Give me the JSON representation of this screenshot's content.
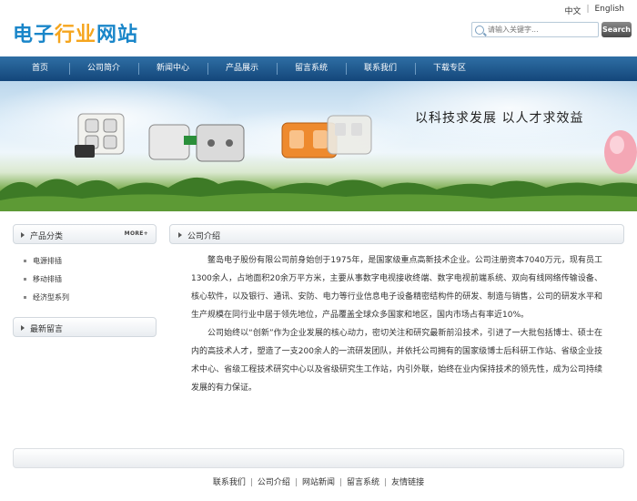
{
  "header": {
    "logo": [
      "电子",
      "行业",
      "网站"
    ],
    "lang": {
      "cn": "中文",
      "en": "English"
    },
    "search": {
      "placeholder": "请输入关键字...",
      "button": "Search"
    }
  },
  "nav": {
    "items": [
      "首页",
      "公司简介",
      "新闻中心",
      "产品展示",
      "留言系统",
      "联系我们",
      "下载专区"
    ]
  },
  "banner": {
    "slogan": "以科技求发展  以人才求效益"
  },
  "sidebar": {
    "products": {
      "title": "产品分类",
      "more": "MORE+",
      "items": [
        "电源排插",
        "移动排插",
        "经济型系列"
      ]
    },
    "messages": {
      "title": "最新留言"
    }
  },
  "main": {
    "title": "公司介绍",
    "paragraphs": [
      "鳖岛电子股份有限公司前身始创于1975年，是国家级重点高新技术企业。公司注册资本7040万元，现有员工1300余人，占地面积20余万平方米，主要从事数字电视接收终端、数字电视前端系统、双向有线网络传输设备、核心软件，以及银行、通讯、安防、电力等行业信息电子设备精密结构件的研发、制造与销售，公司的研发水平和生产规模在同行业中居于领先地位，产品覆盖全球众多国家和地区，国内市场占有率近10%。",
      "公司始终以“创新”作为企业发展的核心动力，密切关注和研究最新前沿技术，引进了一大批包括博士、硕士在内的高技术人才，塑造了一支200余人的一流研发团队，并依托公司拥有的国家级博士后科研工作站、省级企业技术中心、省级工程技术研究中心以及省级研究生工作站，内引外联，始终在业内保持技术的领先性，成为公司持续发展的有力保证。"
    ]
  },
  "footer": {
    "links": [
      "联系我们",
      "公司介绍",
      "网站新闻",
      "留言系统",
      "友情链接"
    ]
  }
}
